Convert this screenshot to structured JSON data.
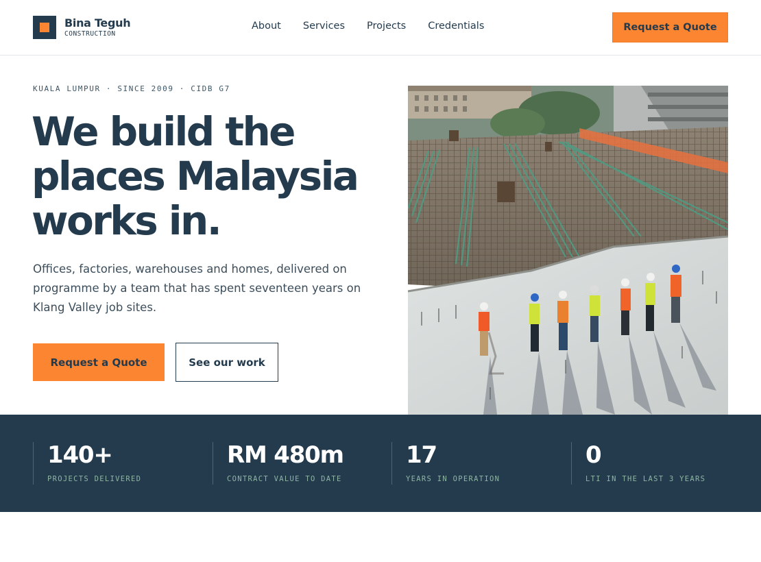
{
  "brand": {
    "name": "Bina Teguh",
    "tagline": "CONSTRUCTION",
    "accent": "#fb8531",
    "navy": "#243b4e"
  },
  "nav": {
    "items": [
      {
        "label": "About"
      },
      {
        "label": "Services"
      },
      {
        "label": "Projects"
      },
      {
        "label": "Credentials"
      }
    ],
    "cta_label": "Request a Quote"
  },
  "hero": {
    "eyebrow": "KUALA LUMPUR · SINCE 2009 · CIDB G7",
    "headline_lines": [
      "We build the",
      "places Malaysia",
      "works in."
    ],
    "lede": "Offices, factories, warehouses and homes, delivered on programme by a team that has spent seventeen years on Klang Valley job sites.",
    "primary_cta": "Request a Quote",
    "secondary_cta": "See our work",
    "photo": "construction-site-photo"
  },
  "stats": [
    {
      "value": "140+",
      "label": "PROJECTS DELIVERED"
    },
    {
      "value": "RM 480m",
      "label": "CONTRACT VALUE TO DATE"
    },
    {
      "value": "17",
      "label": "YEARS IN OPERATION"
    },
    {
      "value": "0",
      "label": "LTI IN THE LAST 3 YEARS"
    }
  ]
}
